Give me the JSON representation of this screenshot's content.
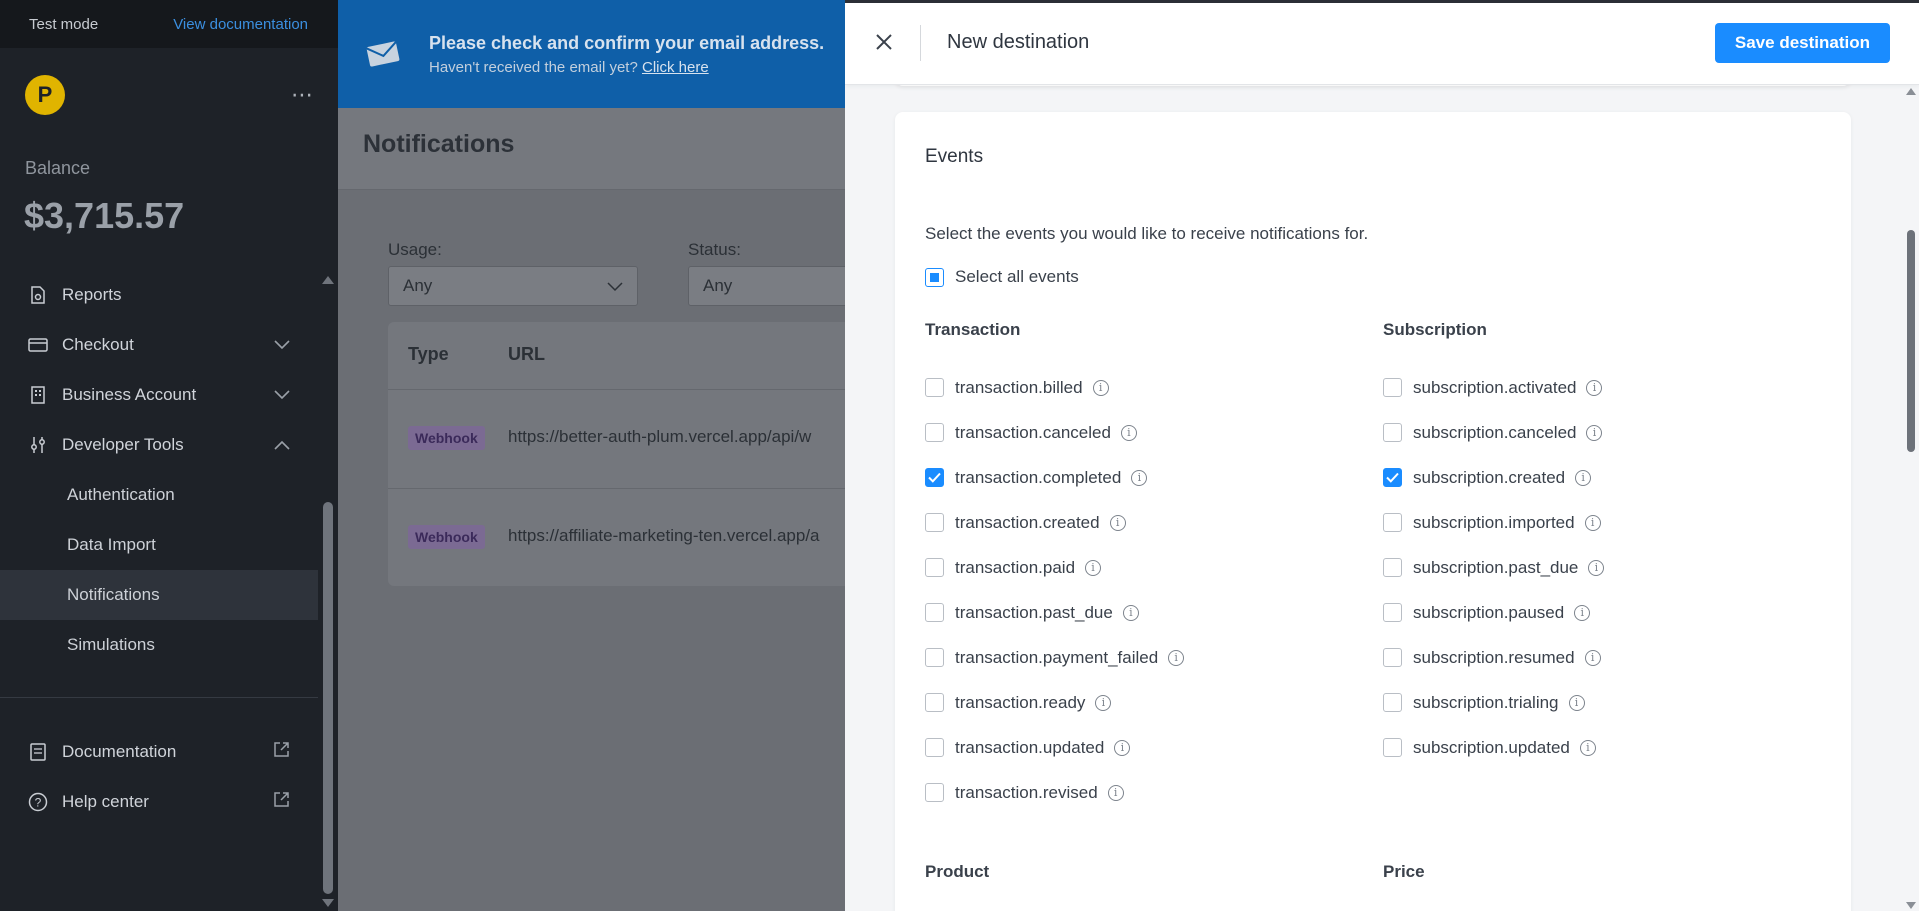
{
  "sidebar": {
    "test_mode": "Test mode",
    "view_docs": "View documentation",
    "logo_letter": "P",
    "more": "⋯",
    "balance_label": "Balance",
    "balance_value": "$3,715.57",
    "items": [
      {
        "label": "Reports",
        "icon": "reports-icon"
      },
      {
        "label": "Checkout",
        "icon": "card-icon",
        "chevron": "down"
      },
      {
        "label": "Business Account",
        "icon": "building-icon",
        "chevron": "down"
      },
      {
        "label": "Developer Tools",
        "icon": "sliders-icon",
        "chevron": "up"
      }
    ],
    "sub_items": [
      "Authentication",
      "Data Import",
      "Notifications",
      "Simulations"
    ],
    "active_sub": "Notifications",
    "bottom_items": [
      {
        "label": "Documentation",
        "icon": "book-icon"
      },
      {
        "label": "Help center",
        "icon": "help-icon"
      }
    ]
  },
  "banner": {
    "title": "Please check and confirm your email address.",
    "sub": "Haven't received the email yet?",
    "link": "Click here"
  },
  "page": {
    "title": "Notifications",
    "usage_label": "Usage:",
    "usage_value": "Any",
    "status_label": "Status:",
    "status_value": "Any",
    "col_type": "Type",
    "col_url": "URL",
    "rows": [
      {
        "type": "Webhook",
        "url": "https://better-auth-plum.vercel.app/api/w"
      },
      {
        "type": "Webhook",
        "url": "https://affiliate-marketing-ten.vercel.app/a"
      }
    ]
  },
  "panel": {
    "title": "New destination",
    "save": "Save destination",
    "events_title": "Events",
    "events_desc": "Select the events you would like to receive notifications for.",
    "select_all": "Select all events",
    "transaction_head": "Transaction",
    "subscription_head": "Subscription",
    "transaction_events": [
      {
        "name": "transaction.billed",
        "checked": false
      },
      {
        "name": "transaction.canceled",
        "checked": false
      },
      {
        "name": "transaction.completed",
        "checked": true
      },
      {
        "name": "transaction.created",
        "checked": false
      },
      {
        "name": "transaction.paid",
        "checked": false
      },
      {
        "name": "transaction.past_due",
        "checked": false
      },
      {
        "name": "transaction.payment_failed",
        "checked": false
      },
      {
        "name": "transaction.ready",
        "checked": false
      },
      {
        "name": "transaction.updated",
        "checked": false
      },
      {
        "name": "transaction.revised",
        "checked": false
      }
    ],
    "subscription_events": [
      {
        "name": "subscription.activated",
        "checked": false
      },
      {
        "name": "subscription.canceled",
        "checked": false
      },
      {
        "name": "subscription.created",
        "checked": true
      },
      {
        "name": "subscription.imported",
        "checked": false
      },
      {
        "name": "subscription.past_due",
        "checked": false
      },
      {
        "name": "subscription.paused",
        "checked": false
      },
      {
        "name": "subscription.resumed",
        "checked": false
      },
      {
        "name": "subscription.trialing",
        "checked": false
      },
      {
        "name": "subscription.updated",
        "checked": false
      }
    ],
    "product_head": "Product",
    "price_head": "Price"
  },
  "colors": {
    "accent": "#1a8cff",
    "sidebar_bg": "#1e2228",
    "banner_bg": "#0f5fa8",
    "webhook_badge": "#7b6a93"
  }
}
